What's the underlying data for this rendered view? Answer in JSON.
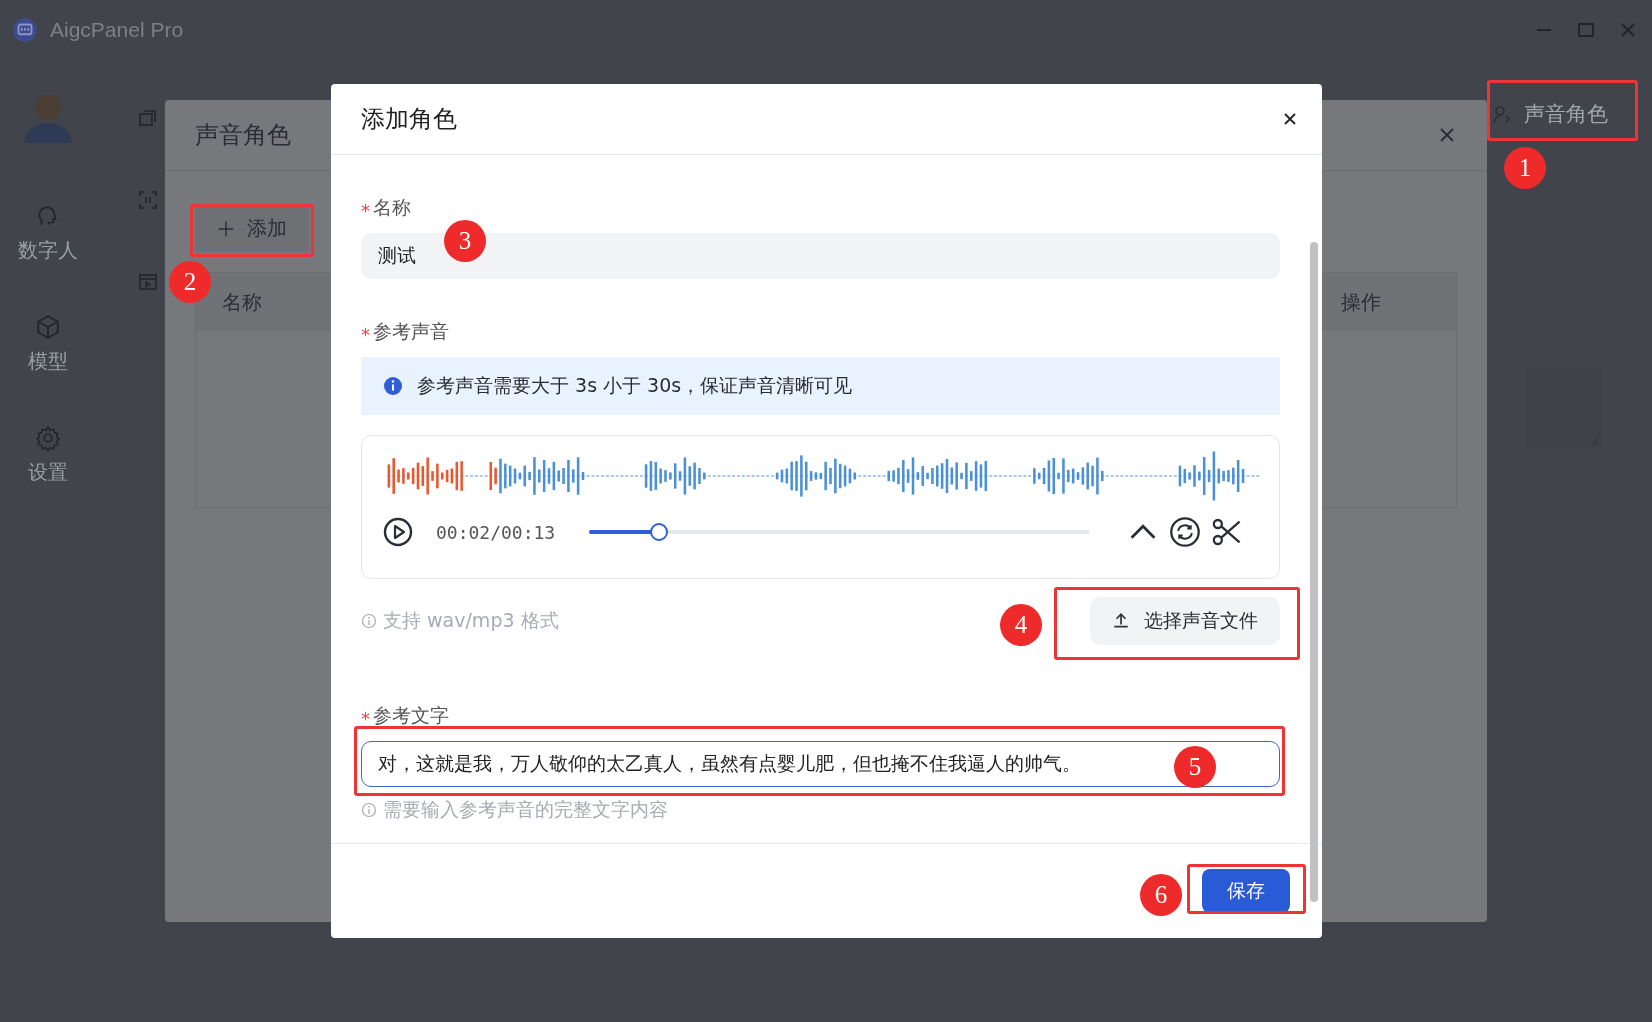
{
  "window": {
    "title": "AigcPanel Pro"
  },
  "sidebar": {
    "items": [
      {
        "label": "数字人"
      },
      {
        "label": "模型"
      },
      {
        "label": "设置"
      }
    ]
  },
  "background_dialog": {
    "title": "声音角色",
    "add_button": "添加",
    "columns": [
      "名称",
      "操作"
    ]
  },
  "right_panel": {
    "item": "声音角色"
  },
  "modal": {
    "title": "添加角色",
    "name": {
      "label": "名称",
      "required": true,
      "required_mark": "*",
      "value": "测试"
    },
    "voice": {
      "label": "参考声音",
      "required": true,
      "required_mark": "*",
      "alert": "参考声音需要大于 3s 小于 30s，保证声音清晰可见",
      "time": "00:02/00:13",
      "level": 0.14,
      "hint": "支持 wav/mp3 格式",
      "upload_button": "选择声音文件"
    },
    "text": {
      "label": "参考文字",
      "required": true,
      "required_mark": "*",
      "value": "对，这就是我，万人敬仰的太乙真人，虽然有点婴儿肥，但也掩不住我逼人的帅气。",
      "focused": true,
      "hint": "需要输入参考声音的完整文字内容"
    },
    "save_button": "保存"
  },
  "annotations": [
    {
      "number": "1"
    },
    {
      "number": "2"
    },
    {
      "number": "3"
    },
    {
      "number": "4"
    },
    {
      "number": "5"
    },
    {
      "number": "6"
    }
  ]
}
